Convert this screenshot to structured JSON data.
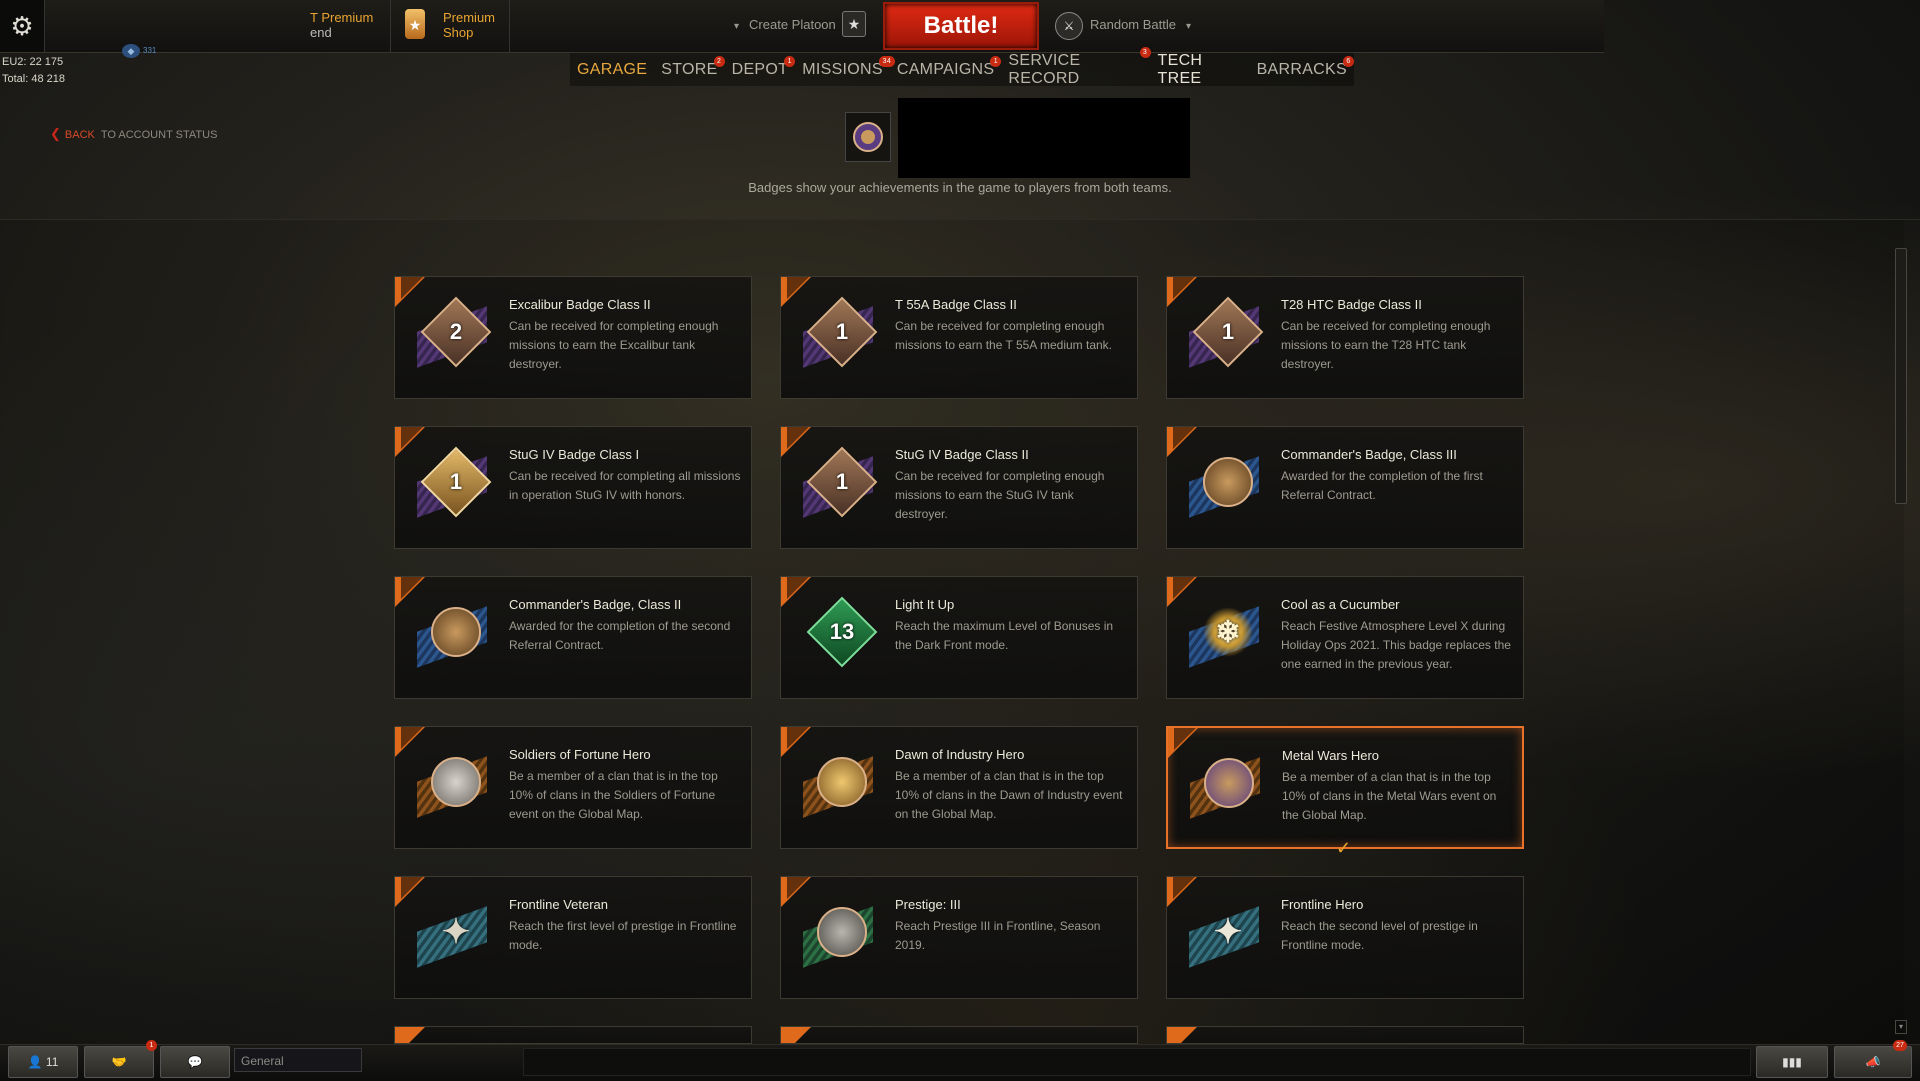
{
  "header": {
    "premium_line1": "T Premium",
    "premium_line2": "end",
    "shop_line1": "Premium",
    "shop_line2": "Shop",
    "create_platoon": "Create Platoon",
    "battle_label": "Battle!",
    "random_battle": "Random Battle"
  },
  "stats": {
    "server_line": "EU2: 22 175",
    "total_line": "Total: 48 218",
    "xp_value": "331"
  },
  "nav": {
    "items": [
      {
        "label": "GARAGE",
        "badge": ""
      },
      {
        "label": "STORE",
        "badge": "2"
      },
      {
        "label": "DEPOT",
        "badge": "1"
      },
      {
        "label": "MISSIONS",
        "badge": "34"
      },
      {
        "label": "CAMPAIGNS",
        "badge": "1"
      },
      {
        "label": "SERVICE RECORD",
        "badge": "3"
      },
      {
        "label": "TECH TREE",
        "badge": ""
      },
      {
        "label": "BARRACKS",
        "badge": "6"
      }
    ]
  },
  "back": {
    "link": "BACK",
    "text": "TO ACCOUNT STATUS"
  },
  "caption": "Badges show your achievements in the game to players from both teams.",
  "badges": [
    {
      "title": "Excalibur Badge Class II",
      "desc": "Can be received for completing enough missions to earn the Excalibur tank destroyer.",
      "num": "2",
      "icon": "diamond-badge-2-icon"
    },
    {
      "title": "T 55A Badge Class II",
      "desc": "Can be received for completing enough missions to earn the T 55A medium tank.",
      "num": "1",
      "icon": "diamond-badge-1-icon"
    },
    {
      "title": "T28 HTC Badge Class II",
      "desc": "Can be received for completing enough missions to earn the T28 HTC tank destroyer.",
      "num": "1",
      "icon": "diamond-badge-1-icon"
    },
    {
      "title": "StuG IV Badge Class I",
      "desc": "Can be received for completing all missions in operation StuG IV with honors.",
      "num": "1",
      "icon": "winged-badge-1-icon"
    },
    {
      "title": "StuG IV Badge Class II",
      "desc": "Can be received for completing enough missions to earn the StuG IV tank destroyer.",
      "num": "1",
      "icon": "diamond-badge-1-icon"
    },
    {
      "title": "Commander's Badge, Class III",
      "desc": "Awarded for the completion of the first Referral Contract.",
      "num": "",
      "icon": "commander-badge-icon"
    },
    {
      "title": "Commander's Badge, Class II",
      "desc": "Awarded for the completion of the second Referral Contract.",
      "num": "",
      "icon": "commander-badge-icon"
    },
    {
      "title": "Light It Up",
      "desc": "Reach the maximum Level of Bonuses in the Dark Front mode.",
      "num": "13",
      "icon": "light-it-up-icon"
    },
    {
      "title": "Cool as a Cucumber",
      "desc": "Reach Festive Atmosphere Level X during Holiday Ops 2021. This badge replaces the one earned in the previous year.",
      "num": "",
      "icon": "snowflake-icon"
    },
    {
      "title": "Soldiers of Fortune Hero",
      "desc": "Be a member of a clan that is in the top 10% of clans in the Soldiers of Fortune event on the Global Map.",
      "num": "",
      "icon": "soldiers-fortune-icon"
    },
    {
      "title": "Dawn of Industry Hero",
      "desc": "Be a member of a clan that is in the top 10% of clans in the Dawn of Industry event on the Global Map.",
      "num": "",
      "icon": "dawn-industry-icon"
    },
    {
      "title": "Metal Wars Hero",
      "desc": "Be a member of a clan that is in the top 10% of clans in the Metal Wars event on the Global Map.",
      "num": "",
      "icon": "metal-wars-icon"
    },
    {
      "title": "Frontline Veteran",
      "desc": "Reach the first level of prestige in Frontline mode.",
      "num": "",
      "icon": "frontline-star-icon"
    },
    {
      "title": "Prestige: III",
      "desc": "Reach Prestige III in Frontline, Season 2019.",
      "num": "",
      "icon": "prestige-icon"
    },
    {
      "title": "Frontline Hero",
      "desc": "Reach the second level of prestige in Frontline mode.",
      "num": "",
      "icon": "frontline-star-icon"
    }
  ],
  "bottom": {
    "players_count": "11",
    "chat_channel": "General",
    "contacts_badge": "1",
    "notif_badge": "27"
  },
  "colors": {
    "accent": "#e8a430",
    "battle_red": "#d8220f",
    "selected_border": "#e8722a"
  }
}
